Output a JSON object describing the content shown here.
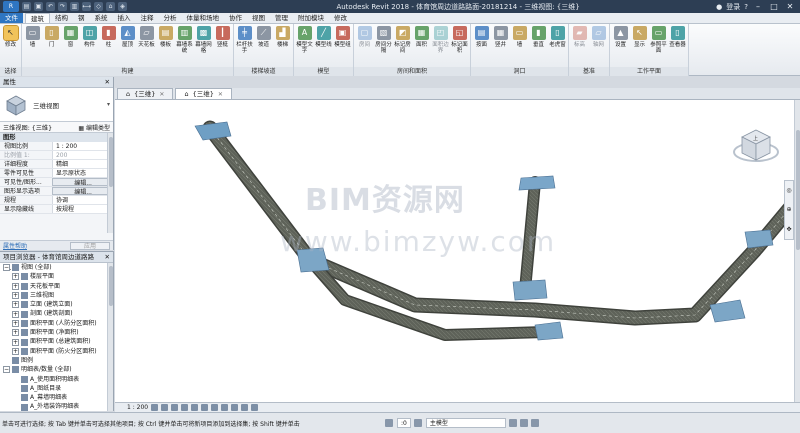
{
  "titlebar": {
    "title": "Autodesk Revit 2018 - 体育馆周边道路路面-20181214 - 三维视图: {三维}",
    "login": "登录",
    "help": "?"
  },
  "ribbon_tabs": [
    "文件",
    "建筑",
    "结构",
    "钢",
    "系统",
    "插入",
    "注释",
    "分析",
    "体量和场地",
    "协作",
    "视图",
    "管理",
    "附加模块",
    "修改"
  ],
  "ribbon": {
    "groups": [
      {
        "label": "选择",
        "buttons": [
          {
            "label": "修改",
            "icon": "cursor-icon"
          }
        ]
      },
      {
        "label": "构建",
        "buttons": [
          {
            "label": "墙",
            "icon": "wall-icon"
          },
          {
            "label": "门",
            "icon": "door-icon"
          },
          {
            "label": "窗",
            "icon": "window-icon"
          },
          {
            "label": "构件",
            "icon": "component-icon"
          },
          {
            "label": "柱",
            "icon": "column-icon"
          },
          {
            "label": "屋顶",
            "icon": "roof-icon"
          },
          {
            "label": "天花板",
            "icon": "ceiling-icon"
          },
          {
            "label": "楼板",
            "icon": "floor-icon"
          },
          {
            "label": "幕墙系统",
            "icon": "curtain-system-icon"
          },
          {
            "label": "幕墙网格",
            "icon": "curtain-grid-icon"
          },
          {
            "label": "竖梃",
            "icon": "mullion-icon"
          }
        ]
      },
      {
        "label": "楼梯坡道",
        "buttons": [
          {
            "label": "栏杆扶手",
            "icon": "railing-icon"
          },
          {
            "label": "坡道",
            "icon": "ramp-icon"
          },
          {
            "label": "楼梯",
            "icon": "stair-icon"
          }
        ]
      },
      {
        "label": "模型",
        "buttons": [
          {
            "label": "模型文字",
            "icon": "model-text-icon"
          },
          {
            "label": "模型线",
            "icon": "model-line-icon"
          },
          {
            "label": "模型组",
            "icon": "model-group-icon"
          }
        ]
      },
      {
        "label": "房间和面积",
        "buttons": [
          {
            "label": "房间",
            "icon": "room-icon"
          },
          {
            "label": "房间分隔",
            "icon": "room-separator-icon"
          },
          {
            "label": "标记房间",
            "icon": "tag-room-icon"
          },
          {
            "label": "面积",
            "icon": "area-icon"
          },
          {
            "label": "面积边界",
            "icon": "area-boundary-icon"
          },
          {
            "label": "标记面积",
            "icon": "tag-area-icon"
          }
        ]
      },
      {
        "label": "洞口",
        "buttons": [
          {
            "label": "按面",
            "icon": "by-face-icon"
          },
          {
            "label": "竖井",
            "icon": "shaft-icon"
          },
          {
            "label": "墙",
            "icon": "wall-opening-icon"
          },
          {
            "label": "垂直",
            "icon": "vertical-icon"
          },
          {
            "label": "老虎窗",
            "icon": "dormer-icon"
          }
        ]
      },
      {
        "label": "基准",
        "buttons": [
          {
            "label": "标高",
            "icon": "level-icon"
          },
          {
            "label": "轴网",
            "icon": "grid-icon"
          }
        ]
      },
      {
        "label": "工作平面",
        "buttons": [
          {
            "label": "设置",
            "icon": "set-icon"
          },
          {
            "label": "显示",
            "icon": "show-icon"
          },
          {
            "label": "参照平面",
            "icon": "ref-plane-icon"
          },
          {
            "label": "查看器",
            "icon": "viewer-icon"
          }
        ]
      }
    ]
  },
  "properties": {
    "header": "属性",
    "type_name": "三维视图",
    "instance_selector": "三维视图: {三维}",
    "edit_type": "编辑类型",
    "section": "图形",
    "rows": [
      {
        "k": "视图比例",
        "v": "1 : 200",
        "muted": false
      },
      {
        "k": "比例值 1:",
        "v": "200",
        "muted": true
      },
      {
        "k": "详细程度",
        "v": "精细",
        "muted": false
      },
      {
        "k": "零件可见性",
        "v": "显示原状态",
        "muted": false
      },
      {
        "k": "可见性/图形...",
        "v": "编辑...",
        "btn": true
      },
      {
        "k": "图形显示选项",
        "v": "编辑...",
        "btn": true
      },
      {
        "k": "规程",
        "v": "协调",
        "muted": false
      },
      {
        "k": "显示隐藏线",
        "v": "按规程",
        "muted": false
      }
    ],
    "help_link": "属性帮助",
    "apply": "应用"
  },
  "browser": {
    "header": "项目浏览器 - 体育馆周边道路路面...",
    "items": [
      {
        "label": "视图 (全部)",
        "level": 0,
        "tog": "−"
      },
      {
        "label": "楼层平面",
        "level": 1,
        "tog": "+"
      },
      {
        "label": "天花板平面",
        "level": 1,
        "tog": "+"
      },
      {
        "label": "三维视图",
        "level": 1,
        "tog": "+"
      },
      {
        "label": "立面 (建筑立面)",
        "level": 1,
        "tog": "+"
      },
      {
        "label": "剖面 (建筑剖面)",
        "level": 1,
        "tog": "+"
      },
      {
        "label": "面积平面 (人防分区面积)",
        "level": 1,
        "tog": "+"
      },
      {
        "label": "面积平面 (净面积)",
        "level": 1,
        "tog": "+"
      },
      {
        "label": "面积平面 (总建筑面积)",
        "level": 1,
        "tog": "+"
      },
      {
        "label": "面积平面 (防火分区面积)",
        "level": 1,
        "tog": "+"
      },
      {
        "label": "图例",
        "level": 0,
        "tog": ""
      },
      {
        "label": "明细表/数量 (全部)",
        "level": 0,
        "tog": "−"
      },
      {
        "label": "A_使用面积明细表",
        "level": 1,
        "tog": ""
      },
      {
        "label": "A_图纸目录",
        "level": 1,
        "tog": ""
      },
      {
        "label": "A_幕墙明细表",
        "level": 1,
        "tog": ""
      },
      {
        "label": "A_外墙装饰明细表",
        "level": 1,
        "tog": ""
      }
    ]
  },
  "view_tabs": [
    {
      "label": "{三维}",
      "active": false
    },
    {
      "label": "{三维}",
      "active": true
    }
  ],
  "watermark": {
    "line1": "BIM资源网",
    "line2": "www.bimzyw.com"
  },
  "viewcube": {
    "face": "上"
  },
  "view_control": {
    "scale": "1 : 200"
  },
  "status": {
    "message": "单击可进行选择; 按 Tab 键并单击可选择其他项目; 按 Ctrl 键并单击可将新项目添加到选择集; 按 Shift 键并单击",
    "zero": ":0",
    "model": "主模型"
  },
  "colors": {
    "accent": "#2f76c2",
    "road": "#5d6158",
    "titlebar": "#2d3e54"
  }
}
